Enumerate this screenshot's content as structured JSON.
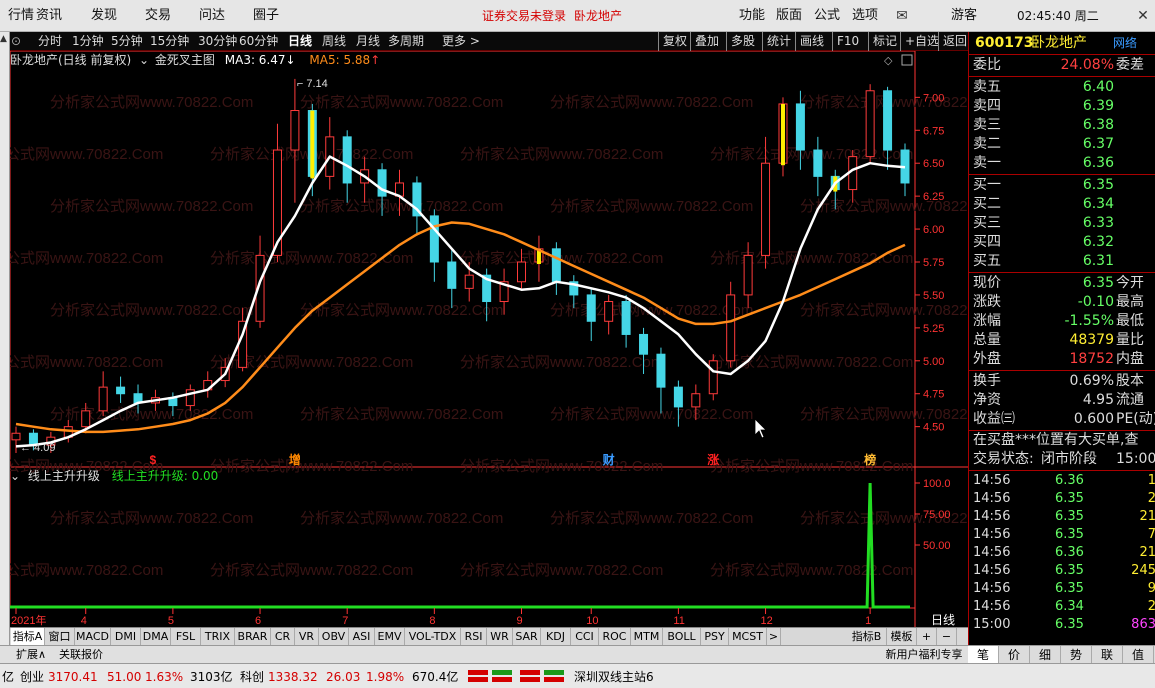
{
  "menubar": {
    "items": [
      "行情",
      "资讯",
      "发现",
      "交易",
      "问达",
      "圈子"
    ],
    "warning": "证券交易未登录",
    "stock_title": "卧龙地产",
    "right_items": [
      "功能",
      "版面",
      "公式",
      "选项"
    ],
    "guest": "游客",
    "clock": "02:45:40 周二"
  },
  "toolbar": {
    "periods": [
      "分时",
      "1分钟",
      "5分钟",
      "15分钟",
      "30分钟",
      "60分钟",
      "日线",
      "周线",
      "月线",
      "多周期",
      "更多 >"
    ],
    "active_period": "日线",
    "actions": [
      "复权",
      "叠加",
      "多股",
      "统计",
      "画线",
      "F10",
      "标记",
      "+自选",
      "返回"
    ]
  },
  "chart_info": {
    "title": "卧龙地产(日线 前复权)",
    "indicator": "金死叉主图",
    "ma3_label": "MA3: 6.47",
    "ma5_label": "MA5: 5.88",
    "high_label": "7.14",
    "low_label": "4.09"
  },
  "watermark": "分析家公式网www.70822.Com",
  "colors": {
    "up": "#ff3b3b",
    "down": "#45d6e6",
    "ma3": "#ffffff",
    "ma5": "#ff8c1a",
    "axis": "#ff3333",
    "sub_line": "#22dd22",
    "highlight": "#ffee00"
  },
  "chart_data": {
    "type": "candlestick",
    "x_labels": [
      "2021年",
      "4",
      "5",
      "6",
      "7",
      "8",
      "9",
      "10",
      "11",
      "12",
      "1"
    ],
    "ylim": [
      4.3,
      7.2
    ],
    "y_ticks": [
      "7.00",
      "6.75",
      "6.50",
      "6.25",
      "6.00",
      "5.75",
      "5.50",
      "5.25",
      "5.00",
      "4.75",
      "4.50"
    ],
    "ma3_points": [
      4.35,
      4.36,
      4.38,
      4.42,
      4.48,
      4.55,
      4.62,
      4.68,
      4.7,
      4.72,
      4.75,
      4.78,
      4.9,
      5.2,
      5.6,
      5.9,
      6.1,
      6.35,
      6.55,
      6.48,
      6.4,
      6.3,
      6.25,
      6.15,
      6.0,
      5.85,
      5.7,
      5.62,
      5.58,
      5.54,
      5.55,
      5.6,
      5.58,
      5.55,
      5.52,
      5.48,
      5.4,
      5.3,
      5.2,
      5.05,
      4.92,
      4.9,
      5.0,
      5.15,
      5.45,
      5.85,
      6.15,
      6.35,
      6.45,
      6.5,
      6.48,
      6.47
    ],
    "ma5_points": [
      4.52,
      4.5,
      4.48,
      4.47,
      4.46,
      4.46,
      4.47,
      4.48,
      4.5,
      4.52,
      4.55,
      4.6,
      4.68,
      4.8,
      4.95,
      5.1,
      5.25,
      5.38,
      5.48,
      5.58,
      5.68,
      5.78,
      5.88,
      5.96,
      6.02,
      6.05,
      6.04,
      6.0,
      5.96,
      5.9,
      5.84,
      5.78,
      5.72,
      5.66,
      5.6,
      5.54,
      5.48,
      5.4,
      5.32,
      5.28,
      5.28,
      5.3,
      5.35,
      5.4,
      5.45,
      5.5,
      5.56,
      5.62,
      5.68,
      5.74,
      5.82,
      5.88
    ],
    "candles": [
      [
        4.4,
        4.45,
        4.3,
        4.5
      ],
      [
        4.45,
        4.36,
        4.32,
        4.48
      ],
      [
        4.36,
        4.42,
        4.3,
        4.46
      ],
      [
        4.42,
        4.5,
        4.38,
        4.55
      ],
      [
        4.5,
        4.62,
        4.45,
        4.68
      ],
      [
        4.62,
        4.8,
        4.58,
        4.92
      ],
      [
        4.8,
        4.75,
        4.68,
        4.88
      ],
      [
        4.75,
        4.68,
        4.6,
        4.82
      ],
      [
        4.68,
        4.72,
        4.62,
        4.78
      ],
      [
        4.72,
        4.66,
        4.58,
        4.76
      ],
      [
        4.66,
        4.78,
        4.62,
        4.82
      ],
      [
        4.78,
        4.85,
        4.72,
        4.92
      ],
      [
        4.85,
        4.95,
        4.8,
        5.02
      ],
      [
        4.95,
        5.3,
        4.92,
        5.4
      ],
      [
        5.3,
        5.8,
        5.25,
        5.95
      ],
      [
        5.8,
        6.6,
        5.75,
        6.8
      ],
      [
        6.6,
        6.9,
        6.2,
        7.14
      ],
      [
        6.9,
        6.4,
        6.25,
        6.95
      ],
      [
        6.4,
        6.7,
        6.3,
        6.85
      ],
      [
        6.7,
        6.35,
        6.2,
        6.75
      ],
      [
        6.35,
        6.45,
        6.2,
        6.55
      ],
      [
        6.45,
        6.25,
        6.1,
        6.5
      ],
      [
        6.25,
        6.35,
        6.1,
        6.45
      ],
      [
        6.35,
        6.1,
        5.95,
        6.4
      ],
      [
        6.1,
        5.75,
        5.6,
        6.15
      ],
      [
        5.75,
        5.55,
        5.4,
        5.85
      ],
      [
        5.55,
        5.65,
        5.45,
        5.75
      ],
      [
        5.65,
        5.45,
        5.3,
        5.7
      ],
      [
        5.45,
        5.6,
        5.35,
        5.7
      ],
      [
        5.6,
        5.75,
        5.55,
        5.85
      ],
      [
        5.75,
        5.85,
        5.6,
        5.95
      ],
      [
        5.85,
        5.6,
        5.5,
        5.9
      ],
      [
        5.6,
        5.5,
        5.4,
        5.65
      ],
      [
        5.5,
        5.3,
        5.15,
        5.55
      ],
      [
        5.3,
        5.45,
        5.2,
        5.5
      ],
      [
        5.45,
        5.2,
        5.1,
        5.5
      ],
      [
        5.2,
        5.05,
        4.9,
        5.25
      ],
      [
        5.05,
        4.8,
        4.6,
        5.1
      ],
      [
        4.8,
        4.65,
        4.5,
        4.85
      ],
      [
        4.65,
        4.75,
        4.55,
        4.82
      ],
      [
        4.75,
        5.0,
        4.7,
        5.05
      ],
      [
        5.0,
        5.5,
        4.95,
        5.6
      ],
      [
        5.5,
        5.8,
        5.4,
        5.9
      ],
      [
        5.8,
        6.5,
        5.7,
        6.7
      ],
      [
        6.5,
        6.95,
        6.4,
        7.0
      ],
      [
        6.95,
        6.6,
        6.45,
        7.05
      ],
      [
        6.6,
        6.4,
        6.25,
        6.7
      ],
      [
        6.4,
        6.3,
        6.15,
        6.45
      ],
      [
        6.3,
        6.55,
        6.2,
        6.6
      ],
      [
        6.55,
        7.05,
        6.5,
        7.1
      ],
      [
        7.05,
        6.6,
        6.45,
        7.08
      ],
      [
        6.6,
        6.35,
        6.25,
        6.65
      ]
    ],
    "event_markers": [
      {
        "label": "$",
        "index": 8,
        "color": "#ff2222"
      },
      {
        "label": "增",
        "index": 16,
        "color": "#ff8800"
      },
      {
        "label": "财",
        "index": 34,
        "color": "#3a9bff"
      },
      {
        "label": "涨",
        "index": 40,
        "color": "#ff2222"
      },
      {
        "label": "榜",
        "index": 49,
        "color": "#ffbb33"
      }
    ],
    "sub": {
      "title": "线上主升升级",
      "value_label": "线上主升升级: 0.00",
      "ylim": [
        0,
        100
      ],
      "y_ticks": [
        "100.0",
        "75.00",
        "50.00"
      ],
      "spike_index": 49,
      "spike_value": 100
    }
  },
  "bottom_tabs": [
    "指标A",
    "窗口",
    "MACD",
    "DMI",
    "DMA",
    "FSL",
    "TRIX",
    "BRAR",
    "CR",
    "VR",
    "OBV",
    "ASI",
    "EMV",
    "VOL-TDX",
    "RSI",
    "WR",
    "SAR",
    "KDJ",
    "CCI",
    "ROC",
    "MTM",
    "BOLL",
    "PSY",
    "MCST",
    ">",
    "指标B",
    "模板",
    "+",
    "−"
  ],
  "bottom_tabs2": [
    "扩展∧",
    "关联报价"
  ],
  "right_panel": {
    "code": "600173",
    "name": "卧龙地产",
    "net_tag": "网络",
    "weibi_label": "委比",
    "weibi_value": "24.08%",
    "weicha_label": "委差",
    "asks": [
      {
        "label": "卖五",
        "price": "6.40"
      },
      {
        "label": "卖四",
        "price": "6.39"
      },
      {
        "label": "卖三",
        "price": "6.38"
      },
      {
        "label": "卖二",
        "price": "6.37"
      },
      {
        "label": "卖一",
        "price": "6.36"
      }
    ],
    "bids": [
      {
        "label": "买一",
        "price": "6.35"
      },
      {
        "label": "买二",
        "price": "6.34"
      },
      {
        "label": "买三",
        "price": "6.33"
      },
      {
        "label": "买四",
        "price": "6.32"
      },
      {
        "label": "买五",
        "price": "6.31"
      }
    ],
    "quote": [
      {
        "l": "现价",
        "v": "6.35",
        "r": "今开",
        "c": "#6f6"
      },
      {
        "l": "涨跌",
        "v": "-0.10",
        "r": "最高",
        "c": "#6f6"
      },
      {
        "l": "涨幅",
        "v": "-1.55%",
        "r": "最低",
        "c": "#6f6"
      },
      {
        "l": "总量",
        "v": "48379",
        "r": "量比",
        "c": "#ffee33"
      },
      {
        "l": "外盘",
        "v": "18752",
        "r": "内盘",
        "c": "#ff4040"
      }
    ],
    "fund": [
      {
        "l": "换手",
        "v": "0.69%",
        "r": "股本"
      },
      {
        "l": "净资",
        "v": "4.95",
        "r": "流通"
      },
      {
        "l": "收益㈢",
        "v": "0.600",
        "r": "PE(动)"
      }
    ],
    "notice": "在买盘***位置有大买单,查",
    "state_label": "交易状态:",
    "state_value": "闭市阶段",
    "state_time": "15:00",
    "ticks": [
      {
        "t": "14:56",
        "p": "6.36",
        "v": "1",
        "c": "#ffee33"
      },
      {
        "t": "14:56",
        "p": "6.35",
        "v": "2",
        "c": "#ffee33"
      },
      {
        "t": "14:56",
        "p": "6.35",
        "v": "21",
        "c": "#ffee33"
      },
      {
        "t": "14:56",
        "p": "6.35",
        "v": "7",
        "c": "#ffee33"
      },
      {
        "t": "14:56",
        "p": "6.36",
        "v": "21",
        "c": "#ffee33"
      },
      {
        "t": "14:56",
        "p": "6.35",
        "v": "245",
        "c": "#ffee33"
      },
      {
        "t": "14:56",
        "p": "6.35",
        "v": "9",
        "c": "#ffee33"
      },
      {
        "t": "14:56",
        "p": "6.34",
        "v": "2",
        "c": "#ffee33"
      },
      {
        "t": "15:00",
        "p": "6.35",
        "v": "863",
        "c": "#ff44ff"
      }
    ],
    "bottom_tabs": [
      "笔",
      "价",
      "细",
      "势",
      "联",
      "值"
    ]
  },
  "status": {
    "item1": "亿",
    "cy_label": "创业",
    "cy_index": "3170.41",
    "cy_change": "51.00",
    "cy_pct": "1.63%",
    "cy_amount": "3103亿",
    "kc_label": "科创",
    "kc_index": "1338.32",
    "kc_change": "26.03",
    "kc_pct": "1.98%",
    "kc_amount": "670.4亿",
    "server": "深圳双线主站6",
    "promo": "新用户福利专享",
    "period_label": "日线"
  }
}
